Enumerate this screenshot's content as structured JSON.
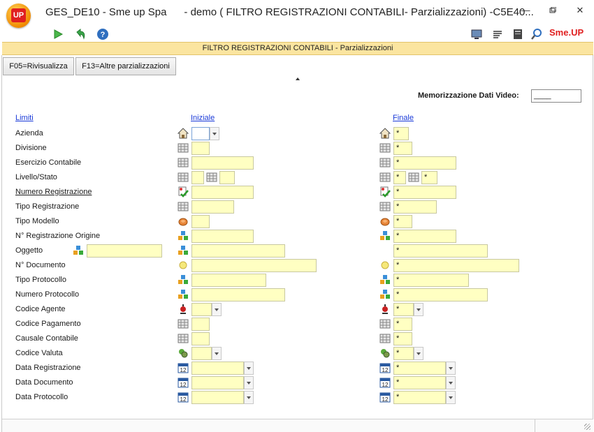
{
  "app": {
    "logo_text": "UP",
    "title": "GES_DE10 - Sme up Spa      - demo ( FILTRO REGISTRAZIONI CONTABILI- Parzializzazioni) -C5E40...",
    "brand_text": "Sme.UP",
    "window_controls": [
      "minimize-icon",
      "maximize-icon",
      "close-icon"
    ]
  },
  "toolbar": {
    "left_icons": [
      "play-icon",
      "back-arrow-icon",
      "help-icon"
    ],
    "right_icons": [
      "monitor-icon",
      "list-icon",
      "document-icon",
      "magnifier-icon"
    ]
  },
  "header": {
    "title": "FILTRO REGISTRAZIONI CONTABILI -  Parzializzazioni"
  },
  "buttons": {
    "f05": "F05=Rivisualizza",
    "f13": "F13=Altre parzializzazioni"
  },
  "memo": {
    "label": "Memorizzazione Dati Video:",
    "value": "____"
  },
  "columns": {
    "limiti": "Limiti",
    "iniziale": "Iniziale",
    "finale": "Finale"
  },
  "rows": [
    {
      "label": "Azienda",
      "icon": "house-icon",
      "initial": "",
      "final": "*"
    },
    {
      "label": "Divisione",
      "icon": "table-icon",
      "initial": "",
      "final": "*"
    },
    {
      "label": "Esercizio Contabile",
      "icon": "table-icon",
      "initial": "",
      "final": "*"
    },
    {
      "label": "Livello/Stato",
      "icon": "table-icon",
      "initial": "",
      "final": "*",
      "initial2": "",
      "final2": "*"
    },
    {
      "label": "Numero Registrazione",
      "icon": "check-doc-icon",
      "initial": "",
      "final": "*"
    },
    {
      "label": "Tipo Registrazione",
      "icon": "table-icon",
      "initial": "",
      "final": "*"
    },
    {
      "label": "Tipo Modello",
      "icon": "coin-icon",
      "initial": "",
      "final": "*"
    },
    {
      "label": "N° Registrazione Origine",
      "icon": "cubes-icon",
      "initial": "",
      "final": "*"
    },
    {
      "label": "Oggetto",
      "icon": "cubes-icon",
      "initial": "",
      "final": "*",
      "extra": ""
    },
    {
      "label": "N° Documento",
      "icon": "circle-icon",
      "initial": "",
      "final": "*"
    },
    {
      "label": "Tipo Protocollo",
      "icon": "cubes-icon",
      "initial": "",
      "final": "*"
    },
    {
      "label": "Numero Protocollo",
      "icon": "cubes-icon",
      "initial": "",
      "final": "*"
    },
    {
      "label": "Codice Agente",
      "icon": "agent-icon",
      "initial": "",
      "final": "*"
    },
    {
      "label": "Codice Pagamento",
      "icon": "table-icon",
      "initial": "",
      "final": "*"
    },
    {
      "label": "Causale Contabile",
      "icon": "table-icon",
      "initial": "",
      "final": "*"
    },
    {
      "label": "Codice Valuta",
      "icon": "currency-icon",
      "initial": "",
      "final": "*"
    },
    {
      "label": "Data Registrazione",
      "icon": "calendar-icon",
      "initial": "",
      "final": "*"
    },
    {
      "label": "Data Documento",
      "icon": "calendar-icon",
      "initial": "",
      "final": "*"
    },
    {
      "label": "Data Protocollo",
      "icon": "calendar-icon",
      "initial": "",
      "final": "*"
    }
  ],
  "colors": {
    "field_bg": "#ffffc2",
    "header_bg": "#fbe5a0",
    "link": "#1a3ad8",
    "brand_red": "#e02020"
  }
}
